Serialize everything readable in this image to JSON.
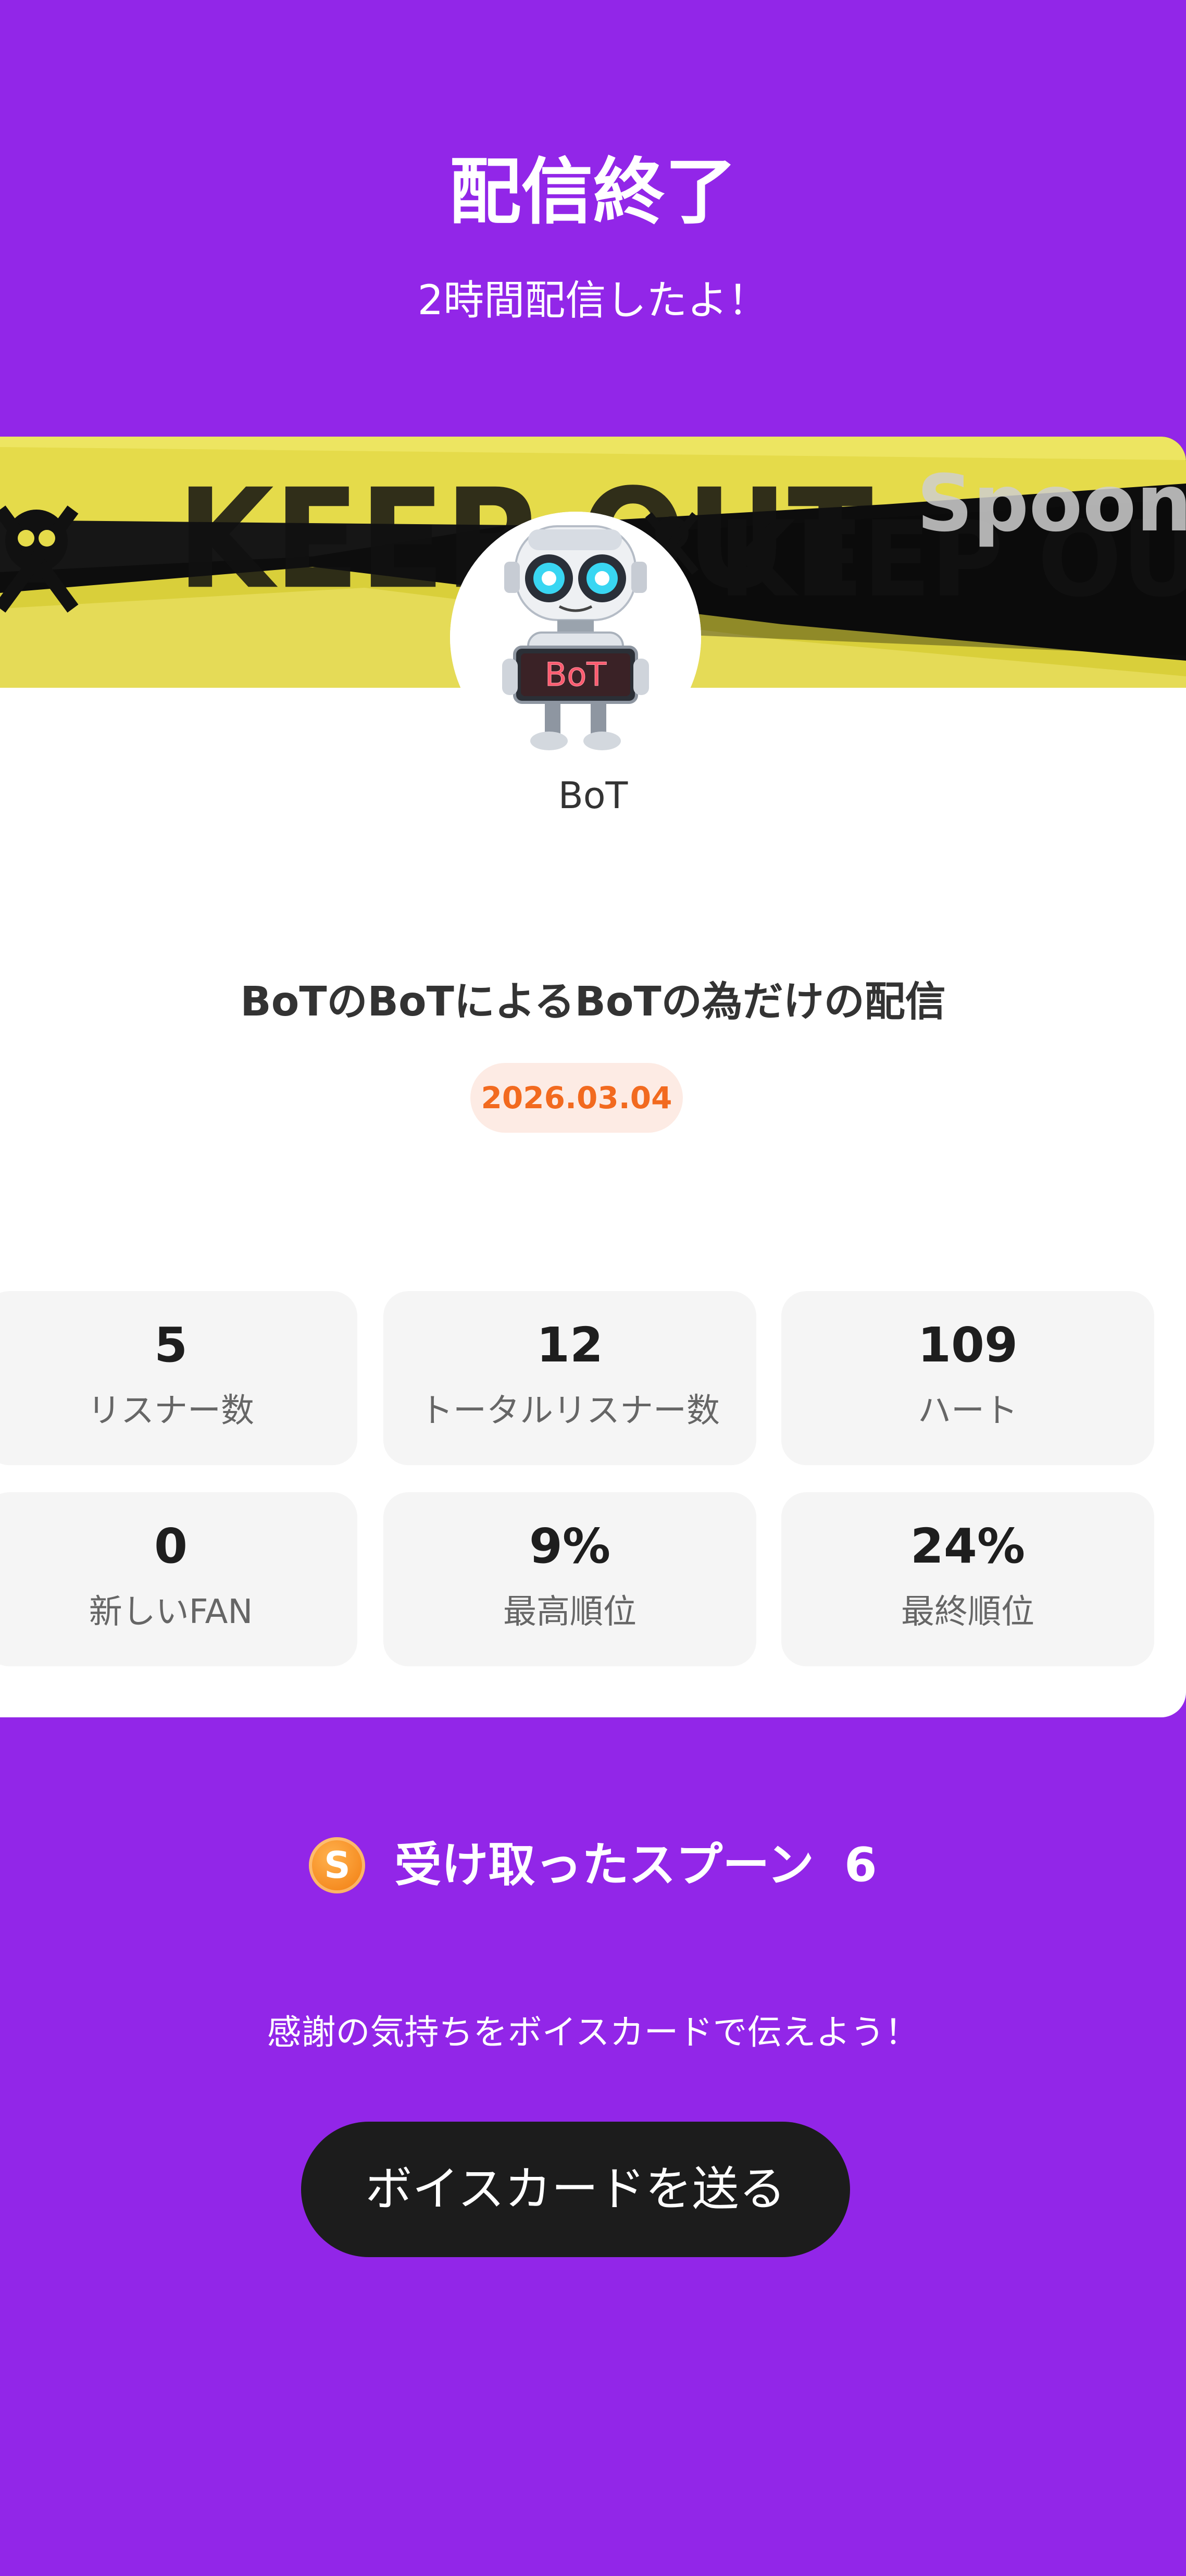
{
  "header": {
    "title": "配信終了",
    "subtitle": "2時間配信したよ！"
  },
  "banner": {
    "tape_text": "KEEP OUT",
    "watermark": "Spoon",
    "avatar_sign_text": "BoT"
  },
  "profile": {
    "username": "BoT"
  },
  "broadcast": {
    "title": "BoTのBoTによるBoTの為だけの配信",
    "date": "2026.03.04"
  },
  "stats": [
    {
      "value": "5",
      "label": "リスナー数"
    },
    {
      "value": "12",
      "label": "トータルリスナー数"
    },
    {
      "value": "109",
      "label": "ハート"
    },
    {
      "value": "0",
      "label": "新しいFAN"
    },
    {
      "value": "9%",
      "label": "最高順位"
    },
    {
      "value": "24%",
      "label": "最終順位"
    }
  ],
  "spoons": {
    "icon": "spoon-coin-icon",
    "coin_letter": "S",
    "label": "受け取ったスプーン",
    "count": "6"
  },
  "voice_card": {
    "message": "感謝の気持ちをボイスカードで伝えよう！",
    "button_label": "ボイスカードを送る"
  },
  "colors": {
    "background": "#9226E8",
    "date_badge_bg": "#FDEBE4",
    "date_badge_text": "#F26A1F",
    "button_bg": "#1C1C1C",
    "stat_bg": "#F5F5F5"
  }
}
